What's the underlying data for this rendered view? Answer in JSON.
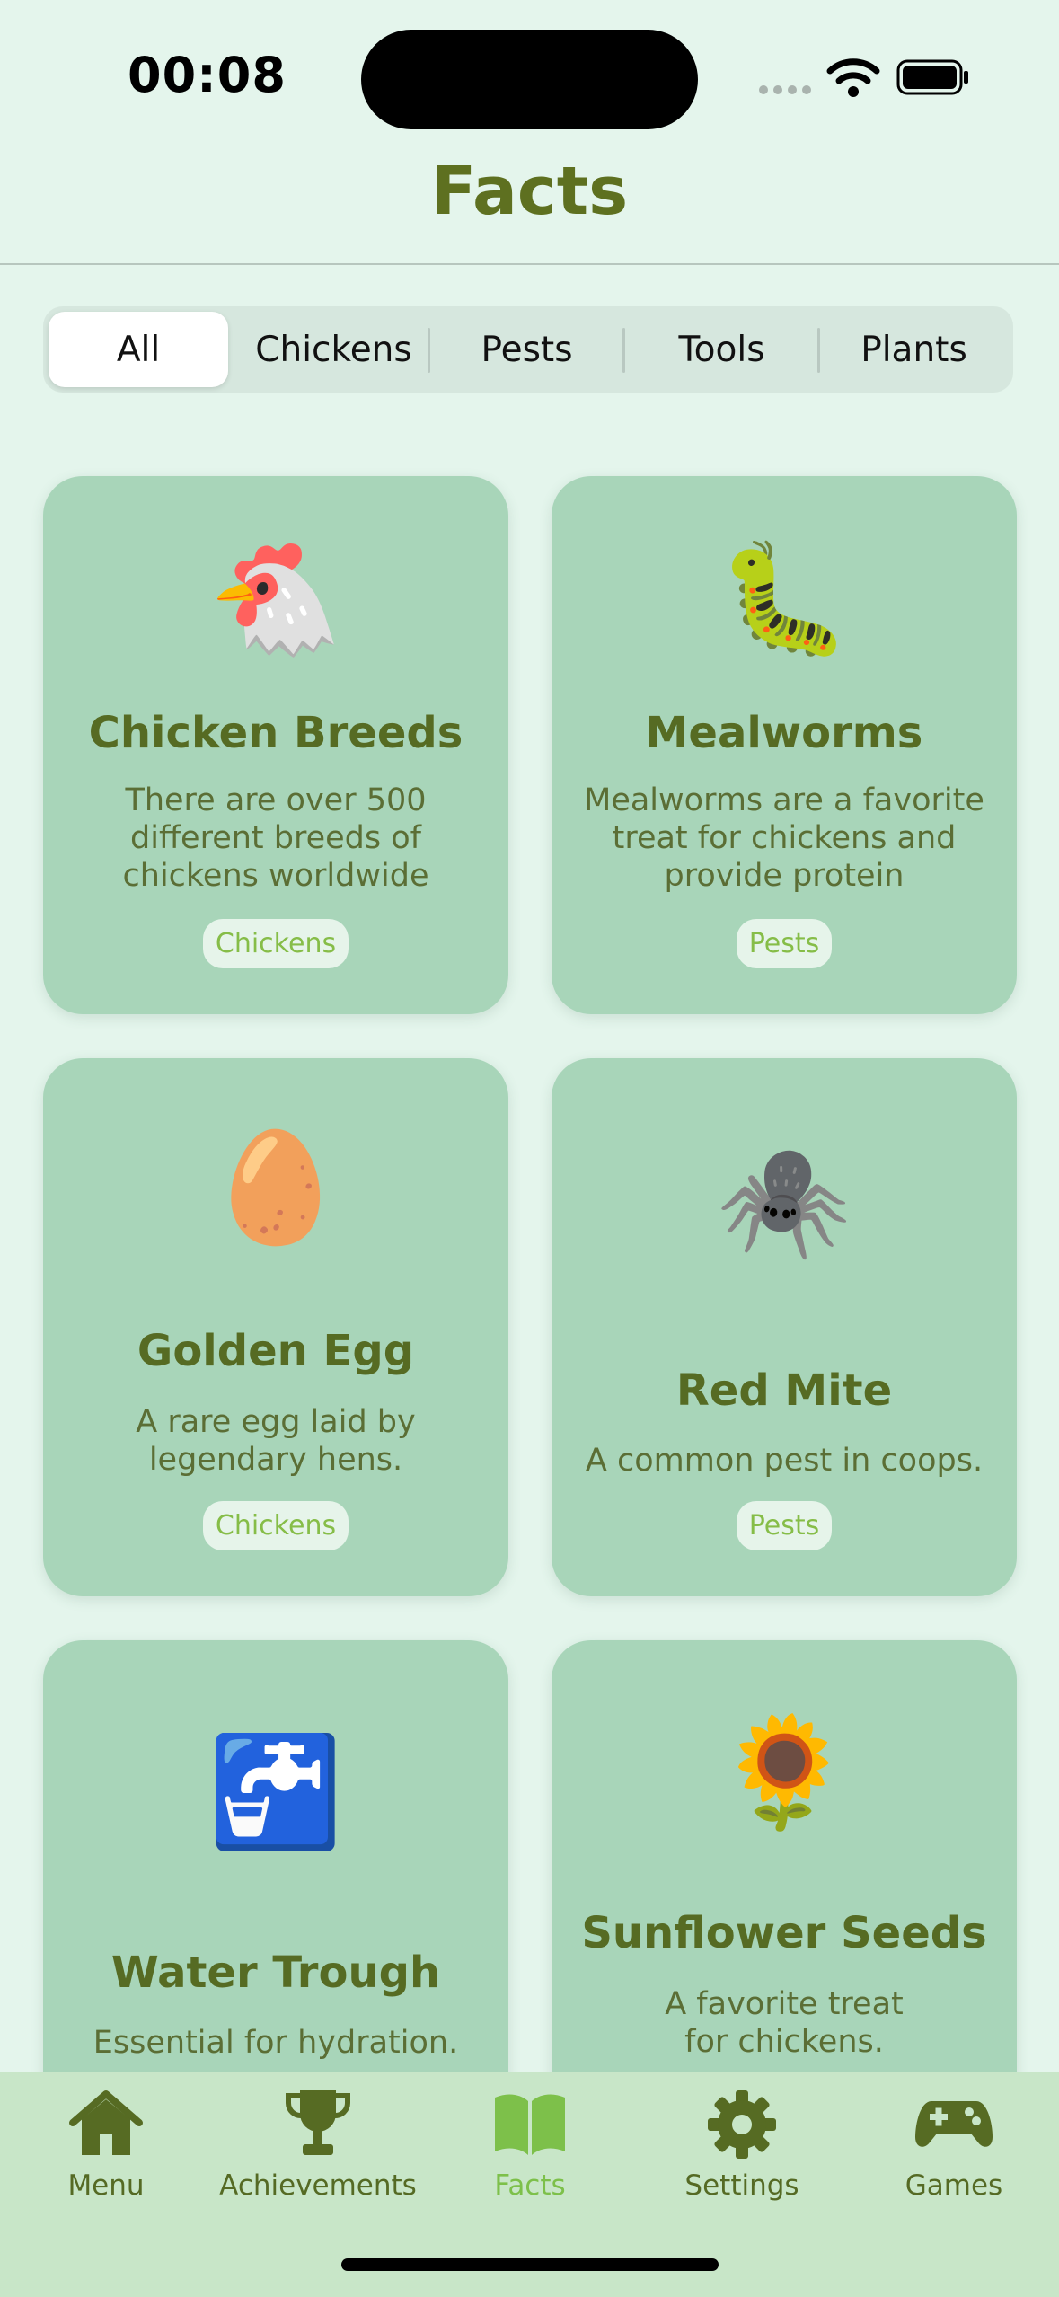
{
  "status_bar": {
    "time": "00:08",
    "icons": [
      "signal-dots-icon",
      "wifi-icon",
      "battery-icon"
    ]
  },
  "header": {
    "title": "Facts"
  },
  "filter": {
    "segments": [
      "All",
      "Chickens",
      "Pests",
      "Tools",
      "Plants"
    ],
    "selected": "All"
  },
  "cards": [
    {
      "emoji": "🐔",
      "icon": "chicken-icon",
      "title": "Chicken Breeds",
      "description": "There are over 500 different breeds of chickens worldwide",
      "category": "Chickens"
    },
    {
      "emoji": "🐛",
      "icon": "caterpillar-icon",
      "title": "Mealworms",
      "description": "Mealworms are a favorite treat for chickens and provide protein",
      "category": "Pests"
    },
    {
      "emoji": "🥚",
      "icon": "egg-icon",
      "title": "Golden Egg",
      "description": "A rare egg laid by legendary hens.",
      "category": "Chickens"
    },
    {
      "emoji": "🕷️",
      "icon": "spider-icon",
      "title": "Red Mite",
      "description": "A common pest in coops.",
      "category": "Pests"
    },
    {
      "emoji": "🚰",
      "icon": "water-tap-icon",
      "title": "Water Trough",
      "description": "Essential for hydration.",
      "category": ""
    },
    {
      "emoji": "🌻",
      "icon": "sunflower-icon",
      "title": "Sunflower Seeds",
      "description": "A favorite treat for chickens.",
      "category": ""
    }
  ],
  "tab_bar": {
    "tabs": [
      {
        "label": "Menu",
        "icon": "house-icon"
      },
      {
        "label": "Achievements",
        "icon": "trophy-icon"
      },
      {
        "label": "Facts",
        "icon": "book-icon"
      },
      {
        "label": "Settings",
        "icon": "gear-icon"
      },
      {
        "label": "Games",
        "icon": "gamepad-icon"
      }
    ],
    "selected": "Facts"
  },
  "colors": {
    "background": "#E4F5EC",
    "card": "#A8D5B9",
    "title_green": "#5E7020",
    "chip_text": "#86BD48",
    "tab_bar": "#C8E6C8",
    "tab_active": "#7DC04A"
  }
}
